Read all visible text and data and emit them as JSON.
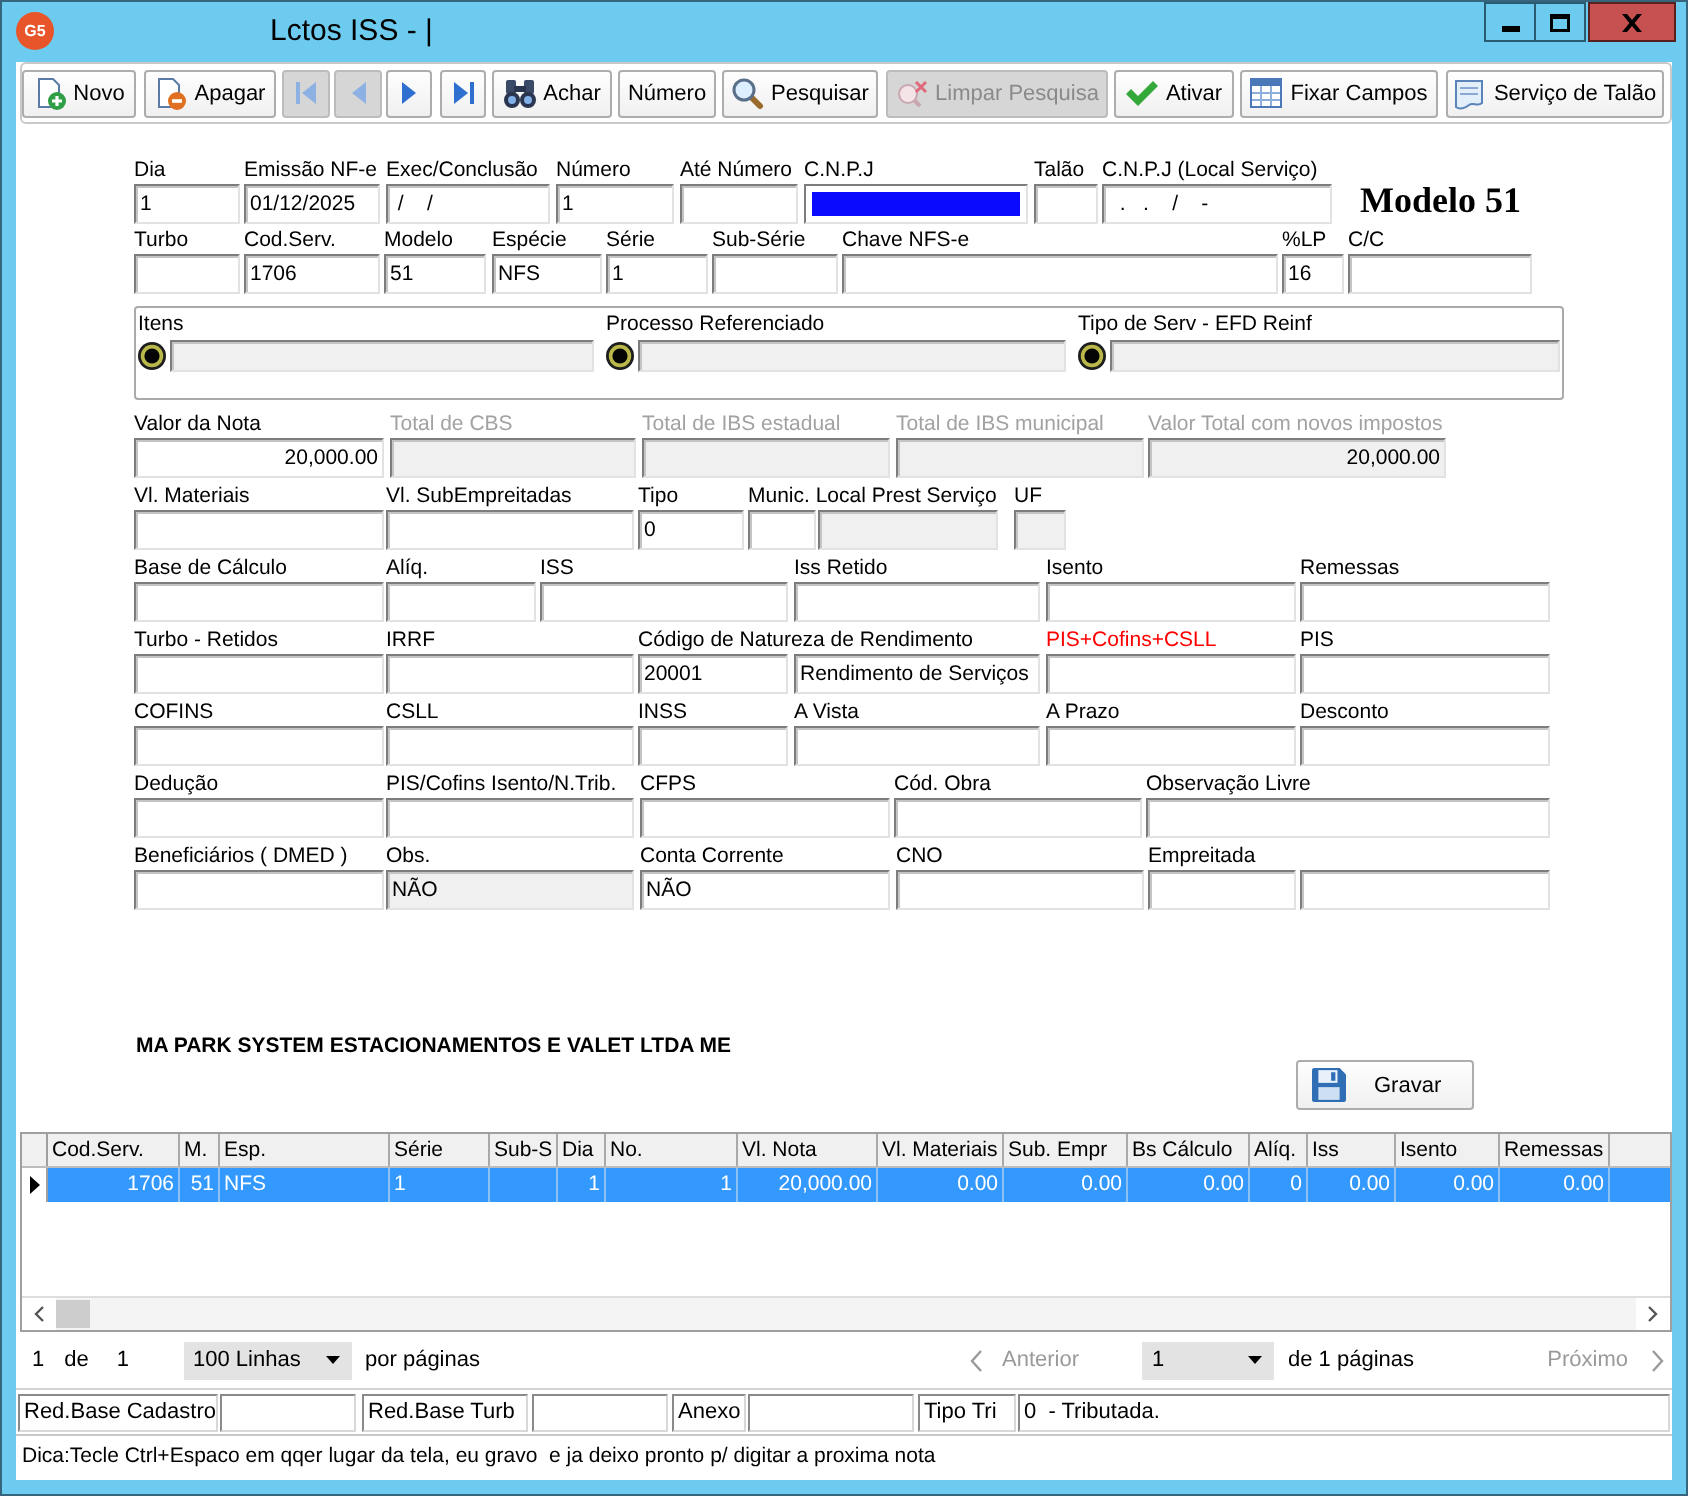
{
  "window": {
    "logo": "G5",
    "title": "Lctos ISS - |"
  },
  "toolbar": [
    {
      "kind": "new",
      "label": "Novo",
      "disabled": false
    },
    {
      "kind": "delete",
      "label": "Apagar",
      "disabled": false
    },
    {
      "kind": "first",
      "disabled": true
    },
    {
      "kind": "prev",
      "disabled": true
    },
    {
      "kind": "next",
      "disabled": false
    },
    {
      "kind": "last",
      "disabled": false
    },
    {
      "kind": "find",
      "label": "Achar",
      "disabled": false
    },
    {
      "kind": "plain",
      "label": "Número",
      "disabled": false
    },
    {
      "kind": "search",
      "label": "Pesquisar",
      "disabled": false
    },
    {
      "kind": "clear",
      "label": "Limpar Pesquisa",
      "disabled": true
    },
    {
      "kind": "activate",
      "label": "Ativar",
      "disabled": false
    },
    {
      "kind": "pin",
      "label": "Fixar Campos",
      "disabled": false
    },
    {
      "kind": "service",
      "label": "Serviço de Talão",
      "disabled": false
    }
  ],
  "form": {
    "model_title": "Modelo 51",
    "header_rows": [
      [
        {
          "label": "Dia",
          "kind": "normal",
          "boxes": [
            {
              "value": "1",
              "kind": "input"
            }
          ]
        },
        {
          "label": "Emissão NF-e",
          "kind": "normal",
          "boxes": [
            {
              "value": "01/12/2025",
              "kind": "input"
            }
          ]
        },
        {
          "label": "Exec/Conclusão",
          "kind": "normal",
          "boxes": [
            {
              "value": " /    /",
              "kind": "input"
            }
          ]
        },
        {
          "label": "Número",
          "kind": "normal",
          "boxes": [
            {
              "value": "1",
              "kind": "input"
            }
          ]
        },
        {
          "label": "Até Número",
          "kind": "normal",
          "boxes": [
            {
              "kind": "input"
            }
          ]
        },
        {
          "label": "C.N.P.J",
          "kind": "normal",
          "boxes": [
            {
              "kind": "selected"
            }
          ]
        },
        {
          "label": "Talão",
          "kind": "normal",
          "boxes": [
            {
              "kind": "input"
            }
          ]
        },
        {
          "label": "C.N.P.J (Local Serviço)",
          "kind": "normal",
          "boxes": [
            {
              "value": "  .   .    /    -",
              "kind": "input"
            }
          ]
        }
      ],
      [
        {
          "label": "Turbo",
          "kind": "normal",
          "boxes": [
            {
              "kind": "input"
            }
          ]
        },
        {
          "label": "Cod.Serv.",
          "kind": "normal",
          "boxes": [
            {
              "value": "1706",
              "kind": "input"
            }
          ]
        },
        {
          "label": "Modelo",
          "kind": "normal",
          "boxes": [
            {
              "value": "51",
              "kind": "input"
            }
          ]
        },
        {
          "label": "Espécie",
          "kind": "normal",
          "boxes": [
            {
              "value": "NFS",
              "kind": "input"
            }
          ]
        },
        {
          "label": "Série",
          "kind": "normal",
          "boxes": [
            {
              "value": "1",
              "kind": "input"
            }
          ]
        },
        {
          "label": "Sub-Série",
          "kind": "normal",
          "boxes": [
            {
              "kind": "input"
            }
          ]
        },
        {
          "label": "Chave NFS-e",
          "kind": "normal",
          "boxes": [
            {
              "kind": "input"
            }
          ]
        },
        {
          "label": "%LP",
          "kind": "normal",
          "boxes": [
            {
              "value": "16",
              "kind": "input"
            }
          ]
        },
        {
          "label": "C/C",
          "kind": "normal",
          "boxes": [
            {
              "kind": "input"
            }
          ]
        }
      ]
    ],
    "lookups": [
      {
        "label": "Itens"
      },
      {
        "label": "Processo Referenciado"
      },
      {
        "label": "Tipo de Serv - EFD Reinf"
      }
    ],
    "value_rows": [
      [
        {
          "label": "Valor da Nota",
          "kind": "normal",
          "boxes": [
            {
              "value": "20,000.00",
              "kind": "input"
            }
          ]
        },
        {
          "label": "Total de CBS",
          "kind": "disabled",
          "boxes": [
            {
              "kind": "readonly"
            }
          ]
        },
        {
          "label": "Total de IBS estadual",
          "kind": "disabled",
          "boxes": [
            {
              "kind": "readonly"
            }
          ]
        },
        {
          "label": "Total de IBS municipal",
          "kind": "disabled",
          "boxes": [
            {
              "kind": "readonly"
            }
          ]
        },
        {
          "label": "Valor Total com novos impostos",
          "kind": "disabled",
          "boxes": [
            {
              "value": "20,000.00",
              "kind": "readonly"
            }
          ]
        }
      ],
      [
        {
          "label": "Vl. Materiais",
          "kind": "normal",
          "boxes": [
            {
              "kind": "input"
            }
          ]
        },
        {
          "label": "Vl. SubEmpreitadas",
          "kind": "normal",
          "boxes": [
            {
              "kind": "input"
            }
          ]
        },
        {
          "label": "Tipo",
          "kind": "normal",
          "boxes": [
            {
              "value": "0",
              "kind": "input"
            }
          ]
        },
        {
          "label": "Munic. Local Prest Serviço",
          "kind": "normal",
          "boxes": [
            {
              "kind": "input"
            },
            {
              "kind": "readonly"
            }
          ]
        },
        {
          "label": "UF",
          "kind": "normal",
          "boxes": [
            {
              "kind": "readonly"
            }
          ]
        }
      ],
      [
        {
          "label": "Base de Cálculo",
          "kind": "normal",
          "boxes": [
            {
              "kind": "input"
            }
          ]
        },
        {
          "label": "Alíq.",
          "kind": "normal",
          "boxes": [
            {
              "kind": "input"
            }
          ]
        },
        {
          "label": "ISS",
          "kind": "normal",
          "boxes": [
            {
              "kind": "input"
            }
          ]
        },
        {
          "label": "Iss Retido",
          "kind": "normal",
          "boxes": [
            {
              "kind": "input"
            }
          ]
        },
        {
          "label": "Isento",
          "kind": "normal",
          "boxes": [
            {
              "kind": "input"
            }
          ]
        },
        {
          "label": "Remessas",
          "kind": "normal",
          "boxes": [
            {
              "kind": "input"
            }
          ]
        }
      ],
      [
        {
          "label": "Turbo - Retidos",
          "kind": "normal",
          "boxes": [
            {
              "kind": "input"
            }
          ]
        },
        {
          "label": "IRRF",
          "kind": "normal",
          "boxes": [
            {
              "kind": "input"
            }
          ]
        },
        {
          "label": "Código de Natureza de Rendimento",
          "kind": "normal",
          "boxes": [
            {
              "value": "20001",
              "kind": "input"
            },
            {
              "value": "Rendimento de Serviços",
              "kind": "input"
            }
          ]
        },
        {
          "label": "PIS+Cofins+CSLL",
          "kind": "alert",
          "boxes": [
            {
              "kind": "input"
            }
          ]
        },
        {
          "label": "PIS",
          "kind": "normal",
          "boxes": [
            {
              "kind": "input"
            }
          ]
        }
      ],
      [
        {
          "label": "COFINS",
          "kind": "normal",
          "boxes": [
            {
              "kind": "input"
            }
          ]
        },
        {
          "label": "CSLL",
          "kind": "normal",
          "boxes": [
            {
              "kind": "input"
            }
          ]
        },
        {
          "label": "INSS",
          "kind": "normal",
          "boxes": [
            {
              "kind": "input"
            }
          ]
        },
        {
          "label": "A Vista",
          "kind": "normal",
          "boxes": [
            {
              "kind": "input"
            }
          ]
        },
        {
          "label": "A Prazo",
          "kind": "normal",
          "boxes": [
            {
              "kind": "input"
            }
          ]
        },
        {
          "label": "Desconto",
          "kind": "normal",
          "boxes": [
            {
              "kind": "input"
            }
          ]
        }
      ],
      [
        {
          "label": "Dedução",
          "kind": "normal",
          "boxes": [
            {
              "kind": "input"
            }
          ]
        },
        {
          "label": "PIS/Cofins Isento/N.Trib.",
          "kind": "normal",
          "boxes": [
            {
              "kind": "input"
            }
          ]
        },
        {
          "label": "CFPS",
          "kind": "normal",
          "boxes": [
            {
              "kind": "input"
            }
          ]
        },
        {
          "label": "Cód. Obra",
          "kind": "normal",
          "boxes": [
            {
              "kind": "input"
            }
          ]
        },
        {
          "label": "Observação Livre",
          "kind": "normal",
          "boxes": [
            {
              "kind": "input"
            }
          ]
        }
      ],
      [
        {
          "label": "Beneficiários ( DMED )",
          "kind": "normal",
          "boxes": [
            {
              "kind": "input"
            }
          ]
        },
        {
          "label": "Obs.",
          "kind": "normal",
          "boxes": [
            {
              "value": "NÃO",
              "kind": "readonly"
            }
          ]
        },
        {
          "label": "Conta Corrente",
          "kind": "normal",
          "boxes": [
            {
              "value": "NÃO",
              "kind": "input"
            }
          ]
        },
        {
          "label": "CNO",
          "kind": "normal",
          "boxes": [
            {
              "kind": "input"
            }
          ]
        },
        {
          "label": "Empreitada",
          "kind": "normal",
          "boxes": [
            {
              "kind": "input"
            },
            {
              "kind": "input"
            }
          ]
        }
      ]
    ],
    "company": "MA PARK SYSTEM ESTACIONAMENTOS E VALET LTDA ME",
    "save_button": "Gravar"
  },
  "grid": {
    "columns": [
      "Cod.Serv.",
      "M.",
      "Esp.",
      "Série",
      "Sub-S",
      "Dia",
      "No.",
      "Vl. Nota",
      "Vl. Materiais",
      "Sub. Empr",
      "Bs Cálculo",
      "Alíq.",
      "Iss",
      "Isento",
      "Remessas"
    ],
    "rows": [
      {
        "selected": true,
        "cells": [
          "1706",
          "51",
          "NFS",
          "1",
          "",
          "1",
          "1",
          "20,000.00",
          "0.00",
          "0.00",
          "0.00",
          "0",
          "0.00",
          "0.00",
          "0.00"
        ]
      }
    ]
  },
  "pager": {
    "record": "1",
    "of_label": "de",
    "record_total": "1",
    "rows_per_page": "100 Linhas",
    "per_page_label": "por páginas",
    "previous": {
      "label": "Anterior",
      "disabled": true
    },
    "page": "1",
    "pages_label": "de 1 páginas",
    "next": {
      "label": "Próximo",
      "disabled": true
    }
  },
  "info_bar": [
    {
      "label": "Red.Base Cadastro"
    },
    {
      "label": "Red.Base Turb"
    },
    {
      "label": "Anexo"
    },
    {
      "label": "Tipo Tri",
      "value": "0  - Tributada."
    }
  ],
  "tip": "Dica:Tecle Ctrl+Espaco em qqer lugar da tela, eu gravo  e ja deixo pronto p/ digitar a proxima nota"
}
